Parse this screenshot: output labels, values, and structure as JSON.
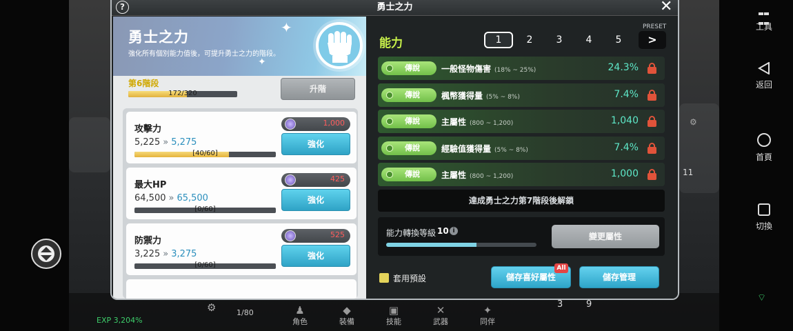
{
  "modal": {
    "title": "勇士之力"
  },
  "banner": {
    "title": "勇士之力",
    "description": "強化所有個別能力值後，可提升勇士之力的階段。",
    "stage_label": "第6階段",
    "stage_progress_text": "172/320",
    "stage_progress": 0.5375,
    "upgrade_button": "升階"
  },
  "stats": [
    {
      "name": "攻擊力",
      "current": "5,225",
      "next": "5,275",
      "cost": "1,000",
      "button": "強化",
      "progress_text": "[40/60]",
      "progress": 0.667
    },
    {
      "name": "最大HP",
      "current": "64,500",
      "next": "65,500",
      "cost": "425",
      "button": "強化",
      "progress_text": "[0/60]",
      "progress": 0
    },
    {
      "name": "防禦力",
      "current": "3,225",
      "next": "3,275",
      "cost": "525",
      "button": "強化",
      "progress_text": "[0/60]",
      "progress": 0
    }
  ],
  "ability": {
    "title": "能力",
    "preset_label": "PRESET",
    "preset_tabs": [
      "1",
      "2",
      "3",
      "4",
      "5"
    ],
    "active_preset": "1",
    "next_button": ">",
    "rows": [
      {
        "grade": "傳說",
        "name": "一般怪物傷害",
        "range": "(18% ~ 25%)",
        "value": "24.3%"
      },
      {
        "grade": "傳說",
        "name": "楓幣獲得量",
        "range": "(5% ~ 8%)",
        "value": "7.4%"
      },
      {
        "grade": "傳說",
        "name": "主屬性",
        "range": "(800 ~ 1,200)",
        "value": "1,040"
      },
      {
        "grade": "傳說",
        "name": "經驗值獲得量",
        "range": "(5% ~ 8%)",
        "value": "7.4%"
      },
      {
        "grade": "傳說",
        "name": "主屬性",
        "range": "(800 ~ 1,200)",
        "value": "1,000"
      }
    ],
    "unlock_text": "達成勇士之力第7階段後解鎖",
    "convert_label": "能力轉換等級",
    "convert_level": "10",
    "convert_progress": 0.6,
    "change_button": "變更屬性",
    "use_preset_label": "套用預設",
    "save_favorite_button": "儲存喜好屬性",
    "all_badge": "All",
    "save_manage_button": "儲存管理"
  },
  "background": {
    "exp_text": "EXP 3,204%",
    "page_count": "1/80",
    "menu": [
      "角色",
      "裝備",
      "技能",
      "武器",
      "同伴"
    ],
    "count_3": "3",
    "count_9": "9",
    "count_11": "11"
  },
  "system_nav": [
    "工具",
    "返回",
    "首頁",
    "切換"
  ],
  "colors": {
    "accent_green": "#c7f04a",
    "value_cyan": "#5ee8c8",
    "button_blue": "#2ea5c9",
    "lock_red": "#e0533a",
    "stage_yellow": "#d0a800"
  }
}
